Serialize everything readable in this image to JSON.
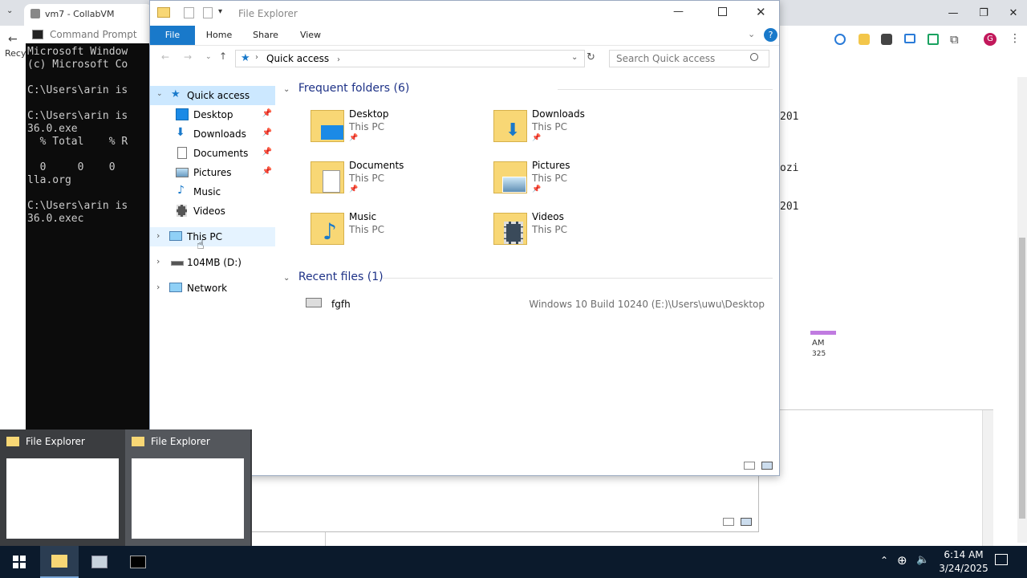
{
  "host": {
    "tab_title": "vm7 - CollabVM",
    "left_partial": "Recy"
  },
  "cmd": {
    "title": "Command Prompt",
    "lines": [
      "Microsoft Windows [",
      "(c) Microsoft Co",
      "",
      "C:\\Users\\arin is",
      "",
      "C:\\Users\\arin is",
      "36.0.exe",
      "  % Total    % R",
      "",
      "  0     0    0",
      "lla.org",
      "",
      "C:\\Users\\arin is",
      "36.0.exec"
    ]
  },
  "bg_right_text": [
    "201",
    "ozi",
    "201",
    "AM",
    "325"
  ],
  "explorer": {
    "title": "File Explorer",
    "tabs": [
      "File",
      "Home",
      "Share",
      "View"
    ],
    "address": "Quick access",
    "search_placeholder": "Search Quick access",
    "nav": {
      "quick_access": "Quick access",
      "items": [
        "Desktop",
        "Downloads",
        "Documents",
        "Pictures",
        "Music",
        "Videos"
      ],
      "this_pc": "This PC",
      "drive": "104MB (D:)",
      "network": "Network"
    },
    "frequent_header": "Frequent folders (6)",
    "folders": [
      {
        "name": "Desktop",
        "loc": "This PC",
        "pinned": true
      },
      {
        "name": "Downloads",
        "loc": "This PC",
        "pinned": true
      },
      {
        "name": "Documents",
        "loc": "This PC",
        "pinned": true
      },
      {
        "name": "Pictures",
        "loc": "This PC",
        "pinned": true
      },
      {
        "name": "Music",
        "loc": "This PC",
        "pinned": false
      },
      {
        "name": "Videos",
        "loc": "This PC",
        "pinned": false
      }
    ],
    "recent_header": "Recent files (1)",
    "recent": [
      {
        "name": "fgfh",
        "path": "Windows 10 Build 10240 (E:)\\Users\\uwu\\Desktop"
      }
    ]
  },
  "thumbnails": [
    "File Explorer",
    "File Explorer"
  ],
  "taskbar": {
    "time": "6:14 AM",
    "date": "3/24/2025"
  },
  "colors": {
    "accent": "#1979ca",
    "taskbar": "#0b1a2c",
    "folder": "#f8d775"
  }
}
